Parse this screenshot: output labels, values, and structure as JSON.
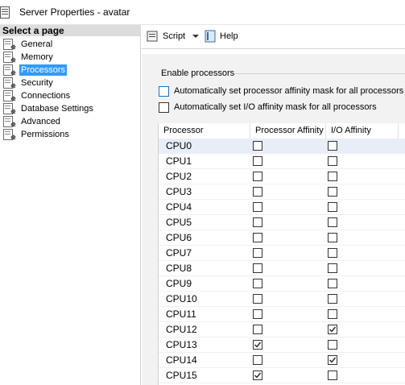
{
  "window": {
    "title": "Server Properties - avatar"
  },
  "sidebar": {
    "header": "Select a page",
    "items": [
      {
        "label": "General",
        "icon": "page-wrench-icon"
      },
      {
        "label": "Memory",
        "icon": "page-wrench-icon"
      },
      {
        "label": "Processors",
        "icon": "page-wrench-icon",
        "selected": true
      },
      {
        "label": "Security",
        "icon": "page-wrench-icon"
      },
      {
        "label": "Connections",
        "icon": "page-wrench-icon"
      },
      {
        "label": "Database Settings",
        "icon": "page-wrench-icon"
      },
      {
        "label": "Advanced",
        "icon": "page-wrench-icon"
      },
      {
        "label": "Permissions",
        "icon": "page-wrench-icon"
      }
    ]
  },
  "toolbar": {
    "script_label": "Script",
    "help_label": "Help"
  },
  "section": {
    "title": "Enable processors",
    "auto_processor_label": "Automatically set processor affinity mask for all processors",
    "auto_io_label": "Automatically set I/O affinity mask for all processors"
  },
  "grid": {
    "columns": [
      "Processor",
      "Processor Affinity",
      "I/O Affinity"
    ],
    "rows": [
      {
        "name": "CPU0",
        "processor_affinity": false,
        "io_affinity": false
      },
      {
        "name": "CPU1",
        "processor_affinity": false,
        "io_affinity": false
      },
      {
        "name": "CPU2",
        "processor_affinity": false,
        "io_affinity": false
      },
      {
        "name": "CPU3",
        "processor_affinity": false,
        "io_affinity": false
      },
      {
        "name": "CPU4",
        "processor_affinity": false,
        "io_affinity": false
      },
      {
        "name": "CPU5",
        "processor_affinity": false,
        "io_affinity": false
      },
      {
        "name": "CPU6",
        "processor_affinity": false,
        "io_affinity": false
      },
      {
        "name": "CPU7",
        "processor_affinity": false,
        "io_affinity": false
      },
      {
        "name": "CPU8",
        "processor_affinity": false,
        "io_affinity": false
      },
      {
        "name": "CPU9",
        "processor_affinity": false,
        "io_affinity": false
      },
      {
        "name": "CPU10",
        "processor_affinity": false,
        "io_affinity": false
      },
      {
        "name": "CPU11",
        "processor_affinity": false,
        "io_affinity": false
      },
      {
        "name": "CPU12",
        "processor_affinity": false,
        "io_affinity": true
      },
      {
        "name": "CPU13",
        "processor_affinity": true,
        "io_affinity": false
      },
      {
        "name": "CPU14",
        "processor_affinity": false,
        "io_affinity": true
      },
      {
        "name": "CPU15",
        "processor_affinity": true,
        "io_affinity": false
      }
    ]
  },
  "colors": {
    "selection": "#3399ff",
    "panel": "#f2f2f2",
    "header": "#dcdcdc"
  }
}
